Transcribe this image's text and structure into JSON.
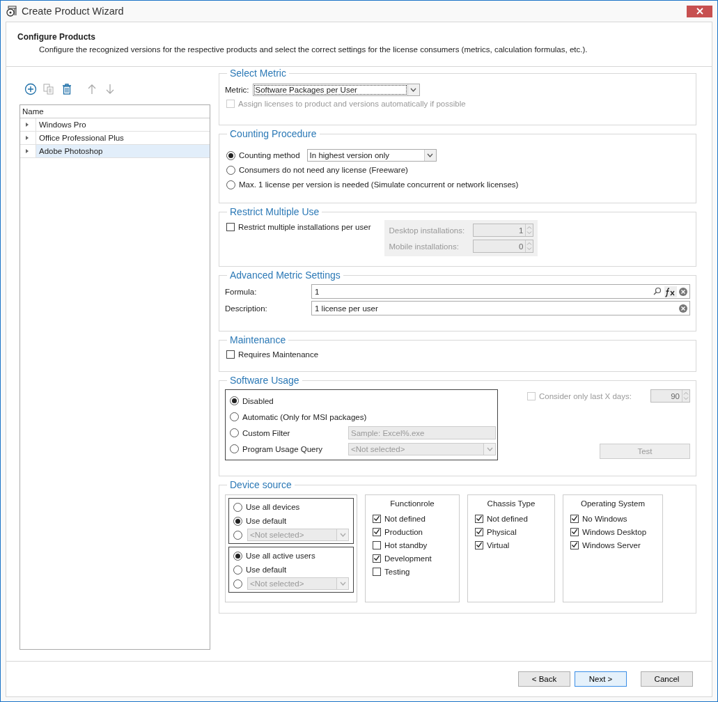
{
  "window": {
    "title": "Create Product Wizard"
  },
  "header": {
    "title": "Configure Products",
    "description": "Configure the recognized versions for the respective products and select the correct settings for the license consumers (metrics, calculation formulas, etc.)."
  },
  "toolbar": [
    {
      "kind": "add",
      "disabled": false
    },
    {
      "kind": "copy",
      "disabled": true
    },
    {
      "kind": "delete",
      "disabled": false
    },
    {
      "kind": "up",
      "disabled": true
    },
    {
      "kind": "down",
      "disabled": true
    }
  ],
  "product_list": {
    "column": "Name",
    "items": [
      {
        "label": "Windows Pro",
        "selected": false
      },
      {
        "label": "Office Professional Plus",
        "selected": false
      },
      {
        "label": "Adobe Photoshop",
        "selected": true
      }
    ]
  },
  "select_metric": {
    "title": "Select Metric",
    "metric_label": "Metric:",
    "metric_value": "Software Packages per User",
    "auto_assign": {
      "label": "Assign licenses to product and versions automatically if possible",
      "checked": false,
      "disabled": true
    }
  },
  "counting_procedure": {
    "title": "Counting Procedure",
    "options": [
      {
        "label": "Counting method",
        "selected": true,
        "dropdown": "In highest version only"
      },
      {
        "label": "Consumers do not need any license (Freeware)",
        "selected": false
      },
      {
        "label": "Max. 1 license per version is needed (Simulate concurrent or network licenses)",
        "selected": false
      }
    ]
  },
  "restrict_multiple_use": {
    "title": "Restrict Multiple Use",
    "checkbox": {
      "label": "Restrict multiple installations per user",
      "checked": false
    },
    "fields": [
      {
        "label": "Desktop installations:",
        "value": "1"
      },
      {
        "label": "Mobile installations:",
        "value": "0"
      }
    ]
  },
  "advanced_metric_settings": {
    "title": "Advanced Metric Settings",
    "fields": [
      {
        "kind": "formula",
        "label": "Formula:",
        "value": "1"
      },
      {
        "kind": "text",
        "label": "Description:",
        "value": "1 license per user"
      }
    ]
  },
  "maintenance": {
    "title": "Maintenance",
    "checkbox": {
      "label": "Requires Maintenance",
      "checked": false
    }
  },
  "software_usage": {
    "title": "Software Usage",
    "options": [
      {
        "label": "Disabled",
        "selected": true
      },
      {
        "label": "Automatic (Only for MSI packages)",
        "selected": false
      },
      {
        "label": "Custom Filter",
        "selected": false,
        "field_placeholder": "Sample: Excel%.exe"
      },
      {
        "label": "Program Usage Query",
        "selected": false,
        "dropdown": "<Not selected>"
      }
    ],
    "consider_days": {
      "label": "Consider only last X days:",
      "checked": false,
      "value": "90"
    },
    "test_button": "Test"
  },
  "device_source": {
    "title": "Device source",
    "device_options": [
      {
        "label": "Use all devices",
        "selected": false
      },
      {
        "label": "Use default",
        "selected": true
      },
      {
        "dropdown": "<Not selected>",
        "selected": false
      }
    ],
    "user_options": [
      {
        "label": "Use all active users",
        "selected": true
      },
      {
        "label": "Use default",
        "selected": false
      },
      {
        "dropdown": "<Not selected>",
        "selected": false
      }
    ],
    "filters": [
      {
        "title": "Functionrole",
        "items": [
          {
            "label": "Not defined",
            "checked": true
          },
          {
            "label": "Production",
            "checked": true
          },
          {
            "label": "Hot standby",
            "checked": false
          },
          {
            "label": "Development",
            "checked": true
          },
          {
            "label": "Testing",
            "checked": false
          }
        ]
      },
      {
        "title": "Chassis Type",
        "items": [
          {
            "label": "Not defined",
            "checked": true
          },
          {
            "label": "Physical",
            "checked": true
          },
          {
            "label": "Virtual",
            "checked": true
          }
        ]
      },
      {
        "title": "Operating System",
        "items": [
          {
            "label": "No Windows",
            "checked": true
          },
          {
            "label": "Windows Desktop",
            "checked": true
          },
          {
            "label": "Windows Server",
            "checked": true
          }
        ]
      }
    ]
  },
  "buttons": [
    {
      "label": "< Back",
      "kind": "normal"
    },
    {
      "label": "Next >",
      "kind": "default"
    },
    {
      "label": "Cancel",
      "kind": "normal"
    }
  ]
}
